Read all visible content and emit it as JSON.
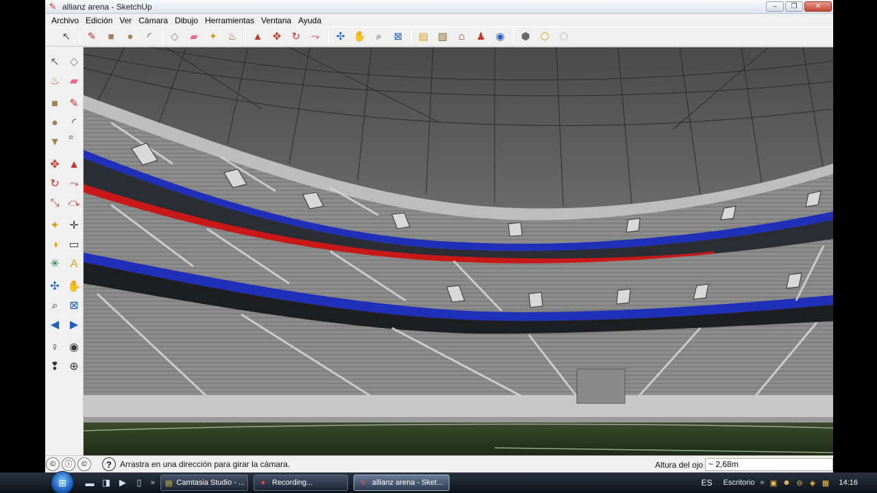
{
  "window": {
    "title": "allianz arena - SketchUp",
    "buttons": {
      "minimize": "–",
      "maximize": "❐",
      "close": "✕"
    }
  },
  "menu": [
    "Archivo",
    "Edición",
    "Ver",
    "Cámara",
    "Dibujo",
    "Herramientas",
    "Ventana",
    "Ayuda"
  ],
  "toolbar": {
    "icons": [
      {
        "name": "select-icon",
        "glyph": "↖",
        "color": "#555555"
      },
      {
        "sep": true
      },
      {
        "name": "pencil-icon",
        "glyph": "✎",
        "color": "#c0392b"
      },
      {
        "name": "rectangle-icon",
        "glyph": "■",
        "color": "#a0825a"
      },
      {
        "name": "circle-icon",
        "glyph": "●",
        "color": "#a0825a"
      },
      {
        "name": "arc-icon",
        "glyph": "◜",
        "color": "#444444"
      },
      {
        "sep": true
      },
      {
        "name": "make-component-icon",
        "glyph": "◇",
        "color": "#888888"
      },
      {
        "name": "eraser-icon",
        "glyph": "▰",
        "color": "#e86a8a"
      },
      {
        "name": "tape-measure-icon",
        "glyph": "✦",
        "color": "#d4a017"
      },
      {
        "name": "paint-bucket-icon",
        "glyph": "♨",
        "color": "#7a6a3a"
      },
      {
        "sep": true
      },
      {
        "name": "push-pull-icon",
        "glyph": "▲",
        "color": "#c0392b"
      },
      {
        "name": "move-icon",
        "glyph": "✥",
        "color": "#c0392b"
      },
      {
        "name": "rotate-icon",
        "glyph": "↻",
        "color": "#c0392b"
      },
      {
        "name": "follow-me-icon",
        "glyph": "⤳",
        "color": "#c0392b"
      },
      {
        "sep": true
      },
      {
        "name": "orbit-icon",
        "glyph": "✣",
        "color": "#1f5fbf"
      },
      {
        "name": "pan-icon",
        "glyph": "✋",
        "color": "#555555"
      },
      {
        "name": "zoom-icon",
        "glyph": "⌕",
        "color": "#333333"
      },
      {
        "name": "zoom-extents-icon",
        "glyph": "⊠",
        "color": "#1f5fbf"
      },
      {
        "sep": true
      },
      {
        "name": "get-models-icon",
        "glyph": "▤",
        "color": "#d4a017"
      },
      {
        "name": "share-model-icon",
        "glyph": "▧",
        "color": "#8a6a2a"
      },
      {
        "name": "place-model-icon",
        "glyph": "⌂",
        "color": "#8a3a2a"
      },
      {
        "name": "get-current-view-icon",
        "glyph": "♟",
        "color": "#c0392b"
      },
      {
        "name": "google-earth-icon",
        "glyph": "◉",
        "color": "#1f5fbf"
      },
      {
        "sep": true
      },
      {
        "name": "components-icon",
        "glyph": "⬢",
        "color": "#6a6a6a"
      },
      {
        "name": "share-component-icon",
        "glyph": "⬡",
        "color": "#d4a017"
      },
      {
        "name": "ruby-icon",
        "glyph": "⬠",
        "color": "#bbbbbb"
      }
    ]
  },
  "left_tools": [
    {
      "name": "select-tool-icon",
      "glyph": "↖",
      "color": "#666666"
    },
    {
      "name": "make-component-tool-icon",
      "glyph": "◇",
      "color": "#888888"
    },
    {
      "name": "paint-bucket-tool-icon",
      "glyph": "♨",
      "color": "#a0825a"
    },
    {
      "name": "eraser-tool-icon",
      "glyph": "▰",
      "color": "#e86a8a"
    },
    {
      "gap": true
    },
    {
      "name": "rectangle-tool-icon",
      "glyph": "■",
      "color": "#a0825a"
    },
    {
      "name": "line-tool-icon",
      "glyph": "✎",
      "color": "#c0392b"
    },
    {
      "name": "circle-tool-icon",
      "glyph": "●",
      "color": "#a0825a"
    },
    {
      "name": "arc-tool-icon",
      "glyph": "◜",
      "color": "#444444"
    },
    {
      "name": "polygon-tool-icon",
      "glyph": "▼",
      "color": "#a0825a"
    },
    {
      "name": "freehand-tool-icon",
      "glyph": "ꩰ",
      "color": "#333333"
    },
    {
      "gap": true
    },
    {
      "name": "move-tool-icon",
      "glyph": "✥",
      "color": "#c0392b"
    },
    {
      "name": "push-pull-tool-icon",
      "glyph": "▲",
      "color": "#c0392b"
    },
    {
      "name": "rotate-tool-icon",
      "glyph": "↻",
      "color": "#c0392b"
    },
    {
      "name": "follow-me-tool-icon",
      "glyph": "⤳",
      "color": "#c0392b"
    },
    {
      "name": "scale-tool-icon",
      "glyph": "⤡",
      "color": "#c0392b"
    },
    {
      "name": "offset-tool-icon",
      "glyph": "⤼",
      "color": "#c0392b"
    },
    {
      "gap": true
    },
    {
      "name": "tape-measure-tool-icon",
      "glyph": "✦",
      "color": "#d4a017"
    },
    {
      "name": "dimension-tool-icon",
      "glyph": "✛",
      "color": "#333333"
    },
    {
      "name": "protractor-tool-icon",
      "glyph": "◑",
      "color": "#d4a017"
    },
    {
      "name": "text-tool-icon",
      "glyph": "▭",
      "color": "#333333"
    },
    {
      "name": "axes-tool-icon",
      "glyph": "✳",
      "color": "#1f7a3a"
    },
    {
      "name": "3d-text-tool-icon",
      "glyph": "A",
      "color": "#d4a017"
    },
    {
      "gap": true
    },
    {
      "name": "orbit-tool-icon",
      "glyph": "✣",
      "color": "#1f5fbf"
    },
    {
      "name": "pan-tool-icon",
      "glyph": "✋",
      "color": "#555555"
    },
    {
      "name": "zoom-tool-icon",
      "glyph": "⌕",
      "color": "#333333"
    },
    {
      "name": "zoom-extents-tool-icon",
      "glyph": "⊠",
      "color": "#1f5fbf"
    },
    {
      "name": "previous-view-icon",
      "glyph": "◀",
      "color": "#1f5fbf"
    },
    {
      "name": "next-view-icon",
      "glyph": "▶",
      "color": "#1f5fbf"
    },
    {
      "gap": true
    },
    {
      "name": "position-camera-tool-icon",
      "glyph": "♀",
      "color": "#333333"
    },
    {
      "name": "look-around-tool-icon",
      "glyph": "◉",
      "color": "#333333"
    },
    {
      "name": "walk-tool-icon",
      "glyph": "❢",
      "color": "#333333"
    },
    {
      "name": "section-plane-tool-icon",
      "glyph": "⊕",
      "color": "#333333"
    }
  ],
  "statusbar": {
    "message": "Arrastra en una dirección para girar la cámara.",
    "help_glyph": "?",
    "icons": [
      "©",
      "ⓘ",
      "©"
    ],
    "vcb_label": "Altura del ojo",
    "vcb_value": "~ 2,68m"
  },
  "taskbar": {
    "start_glyph": "⊞",
    "quick_launch": [
      "▬",
      "◨",
      "▶",
      "▯"
    ],
    "tasks": [
      {
        "label": "Camtasia Studio - ...",
        "icon": "▤",
        "icon_color": "#e0c050",
        "width": 128
      },
      {
        "label": "Recording...",
        "icon": "●",
        "icon_color": "#e04040",
        "width": 138
      },
      {
        "label": "allianz arena - Sket...",
        "icon": "✎",
        "icon_color": "#e06050",
        "width": 140,
        "active": true
      }
    ],
    "language": "ES",
    "desktop_label": "Escritorio",
    "tray_icons": [
      "▣",
      "☻",
      "⊖",
      "◈",
      "▦"
    ],
    "clock": "14:16"
  },
  "colors": {
    "blue_stripe": "#1f2fb8",
    "red_stripe": "#c81818",
    "grass": "#2a3a20",
    "seats": "#8a8a8a"
  }
}
